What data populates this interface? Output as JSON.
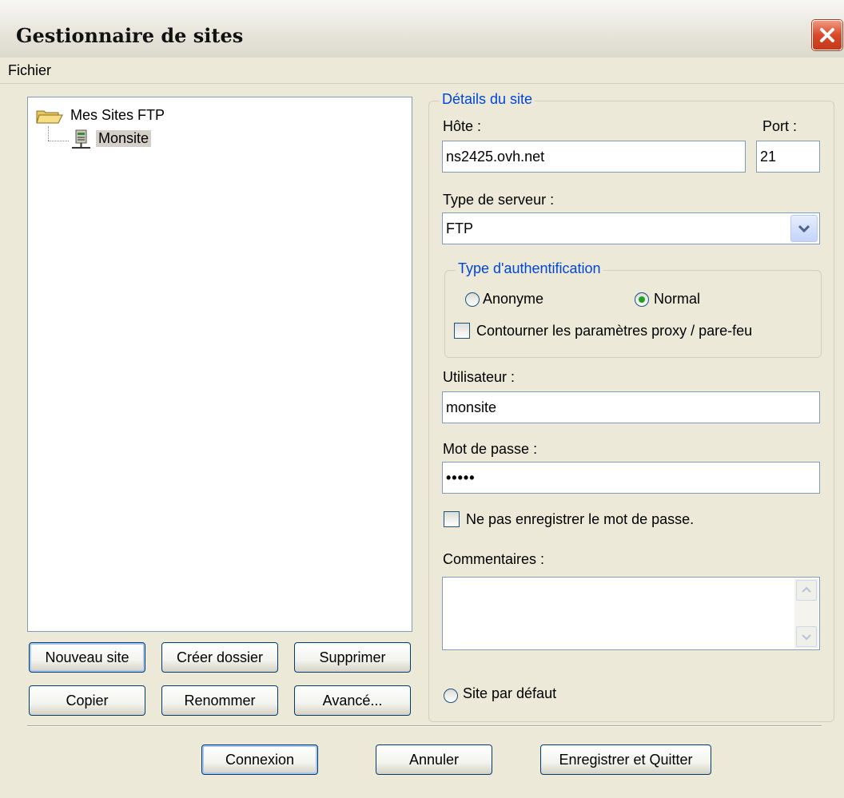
{
  "window": {
    "title": "Gestionnaire de sites",
    "close_icon": "close-icon"
  },
  "menu": {
    "items": [
      "Fichier"
    ]
  },
  "tree": {
    "root_label": "Mes Sites FTP",
    "root_icon": "folder-open-icon",
    "child_label": "Monsite",
    "child_icon": "server-icon"
  },
  "left_buttons": {
    "new_site": "Nouveau site",
    "create_folder": "Créer dossier",
    "delete": "Supprimer",
    "copy": "Copier",
    "rename": "Renommer",
    "advanced": "Avancé..."
  },
  "details": {
    "legend": "Détails du site",
    "host_label": "Hôte :",
    "host_value": "ns2425.ovh.net",
    "port_label": "Port :",
    "port_value": "21",
    "server_type_label": "Type de serveur :",
    "server_type_value": "FTP",
    "auth": {
      "legend": "Type d'authentification",
      "anonymous_label": "Anonyme",
      "anonymous_selected": false,
      "normal_label": "Normal",
      "normal_selected": true,
      "bypass_proxy_label": "Contourner les paramètres proxy / pare-feu",
      "bypass_proxy_checked": false
    },
    "user_label": "Utilisateur :",
    "user_value": "monsite",
    "password_label": "Mot de passe :",
    "password_masked": "•••••",
    "dont_save_password_label": "Ne pas enregistrer le mot de passe.",
    "dont_save_password_checked": false,
    "comments_label": "Commentaires :",
    "comments_value": "",
    "default_site_label": "Site par défaut",
    "default_site_selected": false
  },
  "bottom_buttons": {
    "connect": "Connexion",
    "cancel": "Annuler",
    "save_quit": "Enregistrer et Quitter"
  },
  "colors": {
    "window_bg": "#ece9d8",
    "group_legend": "#0046d5",
    "field_border": "#7f9db9",
    "button_border": "#003c74",
    "close_red": "#d9482a"
  }
}
